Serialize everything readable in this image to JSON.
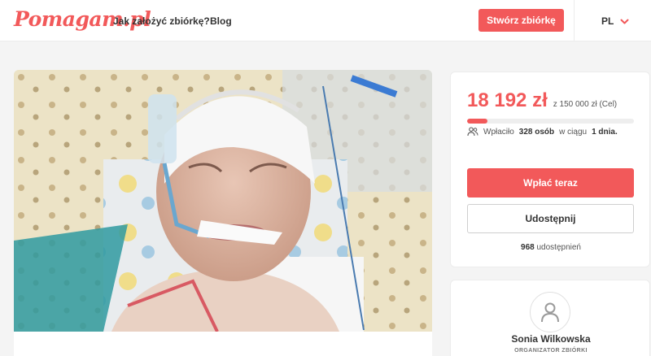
{
  "nav": {
    "logo": "Pomagam.pl",
    "how_to": "Jak założyć zbiórkę?",
    "blog": "Blog",
    "create_button": "Stwórz zbiórkę",
    "language": "PL"
  },
  "campaign": {
    "photo_icon": "campaign-photo"
  },
  "donation": {
    "amount": "18 192 zł",
    "goal": "z 150 000 zł (Cel)",
    "progress": 0.121,
    "donors_prefix": "Wpłaciło",
    "donors_count": "328 osób",
    "donors_middle": "w ciągu",
    "donors_days": "1 dnia.",
    "donate_button": "Wpłać teraz",
    "share_button": "Udostępnij",
    "shares_count": "968",
    "shares_label": "udostępnień"
  },
  "organizer": {
    "name": "Sonia Wilkowska",
    "role": "ORGANIZATOR ZBIÓRKI"
  },
  "colors": {
    "accent": "#f2595a",
    "background": "#f4f4f4"
  }
}
